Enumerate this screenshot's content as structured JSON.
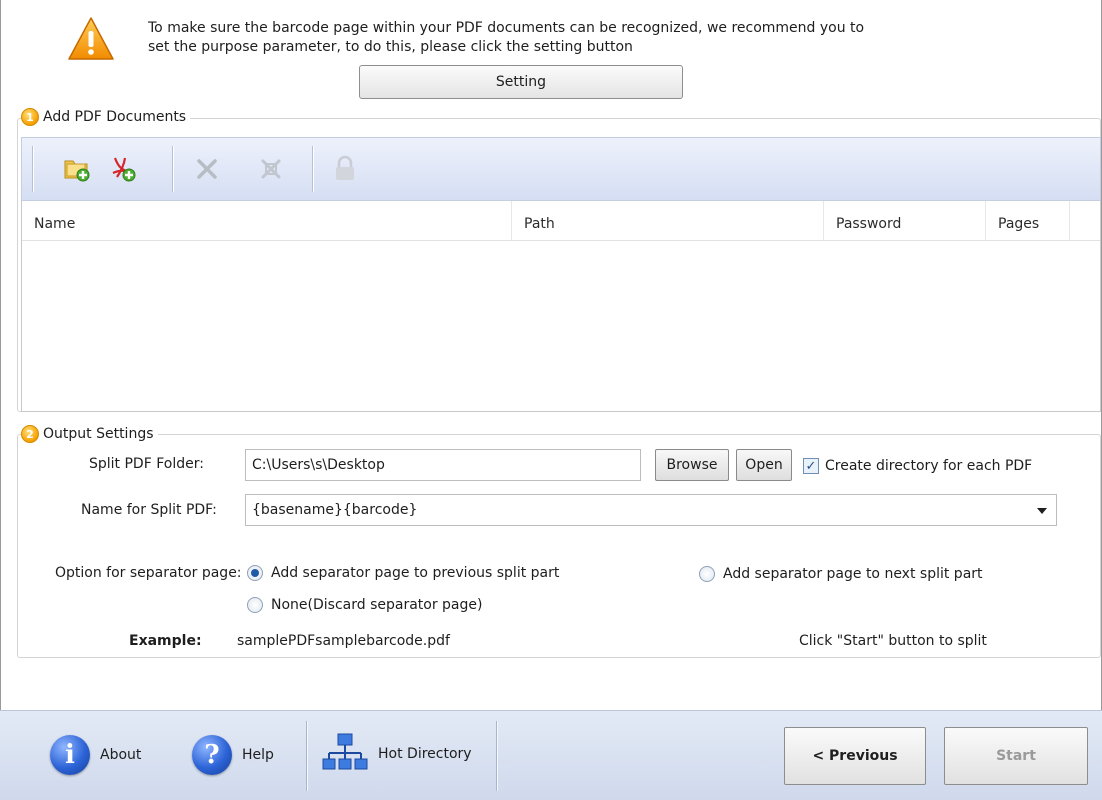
{
  "notice": {
    "line1": "To make sure the barcode page within your PDF documents can be recognized, we recommend you to",
    "line2": "set the purpose parameter, to do this, please click the setting button",
    "setting_label": "Setting"
  },
  "add_docs": {
    "number": "1",
    "title": "Add PDF Documents",
    "toolbar": [
      "add-folder-icon",
      "add-pdf-icon",
      "remove-icon",
      "remove-all-icon",
      "lock-icon"
    ],
    "columns": [
      "Name",
      "Path",
      "Password",
      "Pages"
    ]
  },
  "output": {
    "number": "2",
    "title": "Output Settings",
    "folder_label": "Split PDF Folder:",
    "folder_value": "C:\\Users\\s\\Desktop",
    "browse_label": "Browse",
    "open_label": "Open",
    "create_dir_label": "Create directory for each PDF",
    "create_dir_checked": true,
    "name_label": "Name for Split PDF:",
    "name_value": "{basename}{barcode}",
    "separator_label": "Option for separator page:",
    "opt_previous": "Add separator page to previous split part",
    "opt_next": "Add separator page to next split part",
    "opt_none": "None(Discard separator page)",
    "example_label": "Example:",
    "example_value": "samplePDFsamplebarcode.pdf",
    "hint": "Click \"Start\" button to split"
  },
  "footer": {
    "about": "About",
    "help": "Help",
    "hot_directory": "Hot Directory",
    "previous": "< Previous",
    "start": "Start"
  },
  "colors": {
    "accent": "#2c63d6",
    "toolbar_bg": "#d5def3",
    "footer_bg": "#cfd9ec",
    "badge": "#f6a000"
  }
}
